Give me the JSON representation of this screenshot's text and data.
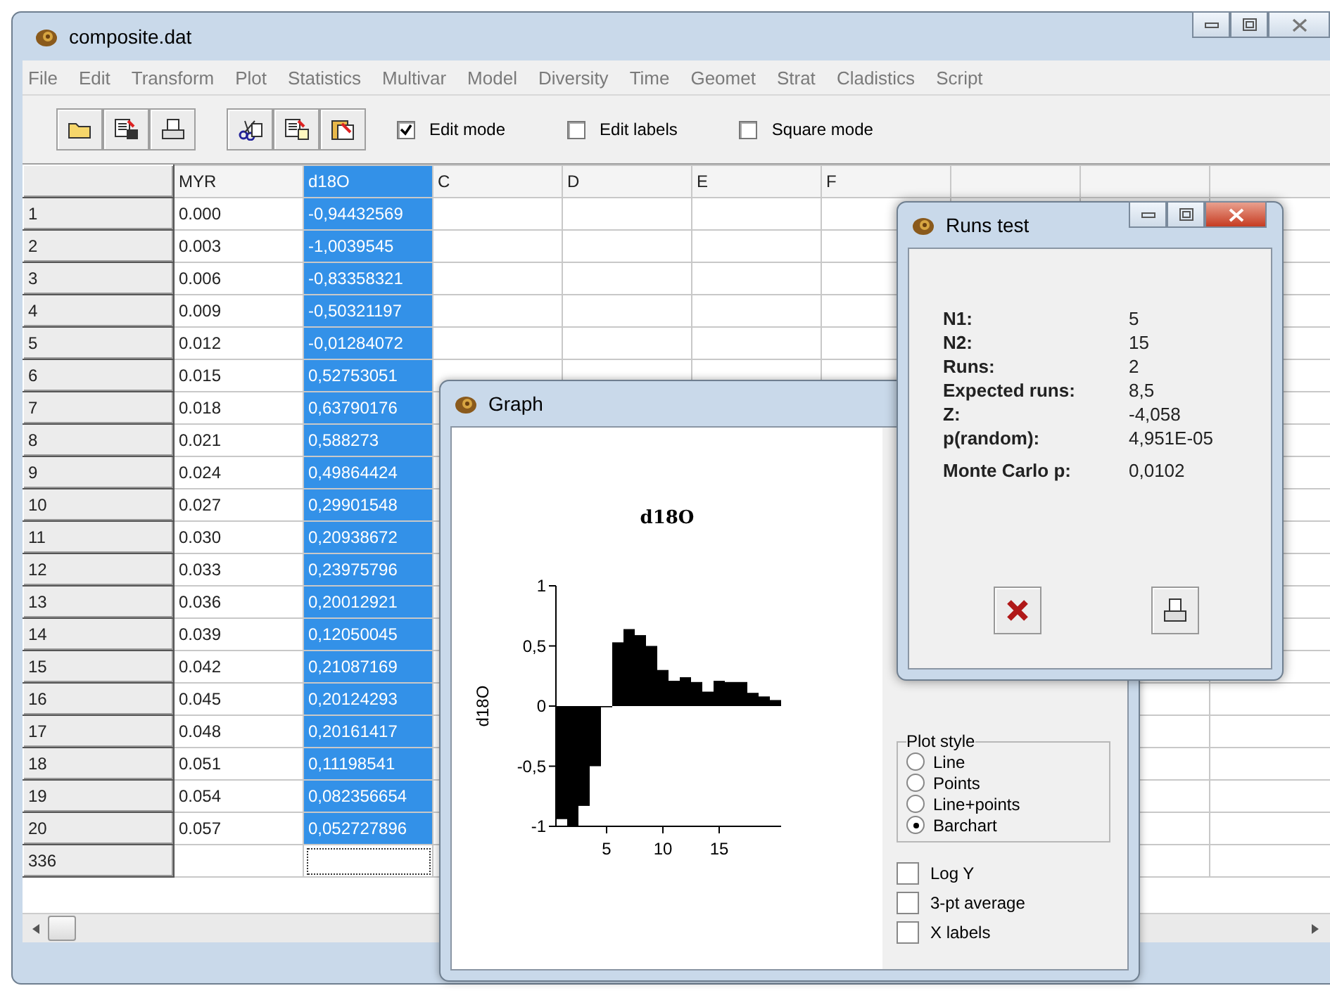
{
  "window": {
    "title": "composite.dat"
  },
  "menu": [
    "File",
    "Edit",
    "Transform",
    "Plot",
    "Statistics",
    "Multivar",
    "Model",
    "Diversity",
    "Time",
    "Geomet",
    "Strat",
    "Cladistics",
    "Script"
  ],
  "toolbar": {
    "options": [
      {
        "label": "Edit mode",
        "checked": true
      },
      {
        "label": "Edit labels",
        "checked": false
      },
      {
        "label": "Square mode",
        "checked": false
      }
    ]
  },
  "table": {
    "columns": [
      {
        "label": "MYR",
        "selected": false
      },
      {
        "label": "d18O",
        "selected": true
      },
      {
        "label": "C",
        "selected": false
      },
      {
        "label": "D",
        "selected": false
      },
      {
        "label": "E",
        "selected": false
      },
      {
        "label": "F",
        "selected": false
      }
    ],
    "rows": [
      {
        "label": "1",
        "cells": [
          "0.000",
          "-0,94432569"
        ],
        "focused": false
      },
      {
        "label": "2",
        "cells": [
          "0.003",
          "-1,0039545"
        ],
        "focused": false
      },
      {
        "label": "3",
        "cells": [
          "0.006",
          "-0,83358321"
        ],
        "focused": false
      },
      {
        "label": "4",
        "cells": [
          "0.009",
          "-0,50321197"
        ],
        "focused": false
      },
      {
        "label": "5",
        "cells": [
          "0.012",
          "-0,01284072"
        ],
        "focused": false
      },
      {
        "label": "6",
        "cells": [
          "0.015",
          "0,52753051"
        ],
        "focused": false
      },
      {
        "label": "7",
        "cells": [
          "0.018",
          "0,63790176"
        ],
        "focused": false
      },
      {
        "label": "8",
        "cells": [
          "0.021",
          "0,588273"
        ],
        "focused": false
      },
      {
        "label": "9",
        "cells": [
          "0.024",
          "0,49864424"
        ],
        "focused": false
      },
      {
        "label": "10",
        "cells": [
          "0.027",
          "0,29901548"
        ],
        "focused": false
      },
      {
        "label": "11",
        "cells": [
          "0.030",
          "0,20938672"
        ],
        "focused": false
      },
      {
        "label": "12",
        "cells": [
          "0.033",
          "0,23975796"
        ],
        "focused": false
      },
      {
        "label": "13",
        "cells": [
          "0.036",
          "0,20012921"
        ],
        "focused": false
      },
      {
        "label": "14",
        "cells": [
          "0.039",
          "0,12050045"
        ],
        "focused": false
      },
      {
        "label": "15",
        "cells": [
          "0.042",
          "0,21087169"
        ],
        "focused": false
      },
      {
        "label": "16",
        "cells": [
          "0.045",
          "0,20124293"
        ],
        "focused": false
      },
      {
        "label": "17",
        "cells": [
          "0.048",
          "0,20161417"
        ],
        "focused": false
      },
      {
        "label": "18",
        "cells": [
          "0.051",
          "0,11198541"
        ],
        "focused": false
      },
      {
        "label": "19",
        "cells": [
          "0.054",
          "0,082356654"
        ],
        "focused": false
      },
      {
        "label": "20",
        "cells": [
          "0.057",
          "0,052727896"
        ],
        "focused": false
      },
      {
        "label": "336",
        "focused": true
      }
    ]
  },
  "graph": {
    "title": "Graph",
    "chart_data": {
      "type": "bar",
      "title": "d18O",
      "ylabel": "d18O",
      "x": [
        1,
        2,
        3,
        4,
        5,
        6,
        7,
        8,
        9,
        10,
        11,
        12,
        13,
        14,
        15,
        16,
        17,
        18,
        19,
        20
      ],
      "values": [
        -0.94,
        -1.0,
        -0.83,
        -0.5,
        -0.01,
        0.53,
        0.64,
        0.59,
        0.5,
        0.3,
        0.21,
        0.24,
        0.2,
        0.12,
        0.21,
        0.2,
        0.2,
        0.11,
        0.08,
        0.05
      ],
      "xlim": [
        0.5,
        20.5
      ],
      "ylim": [
        -1,
        1
      ],
      "xticks": [
        5,
        10,
        15
      ],
      "yticks": [
        {
          "value": -1,
          "label": "-1"
        },
        {
          "value": -0.5,
          "label": "-0,5"
        },
        0,
        {
          "value": 0.5,
          "label": "0,5"
        },
        1
      ]
    },
    "plot_style": {
      "title": "Plot style",
      "options": [
        {
          "label": "Line",
          "selected": false
        },
        {
          "label": "Points",
          "selected": false
        },
        {
          "label": "Line+points",
          "selected": false
        },
        {
          "label": "Barchart",
          "selected": true
        }
      ]
    },
    "options": [
      {
        "label": "Log Y",
        "checked": false
      },
      {
        "label": "3-pt average",
        "checked": false
      },
      {
        "label": "X labels",
        "checked": false
      }
    ]
  },
  "runs_test": {
    "title": "Runs test",
    "stats": [
      {
        "label": "N1:",
        "value": "5"
      },
      {
        "label": "N2:",
        "value": "15"
      },
      {
        "label": "Runs:",
        "value": "2"
      },
      {
        "label": "Expected runs:",
        "value": "8,5"
      },
      {
        "label": "Z:",
        "value": "-4,058"
      },
      {
        "label": "p(random):",
        "value": "4,951E-05"
      },
      {
        "label": "Monte Carlo p:",
        "value": "0,0102"
      }
    ]
  }
}
